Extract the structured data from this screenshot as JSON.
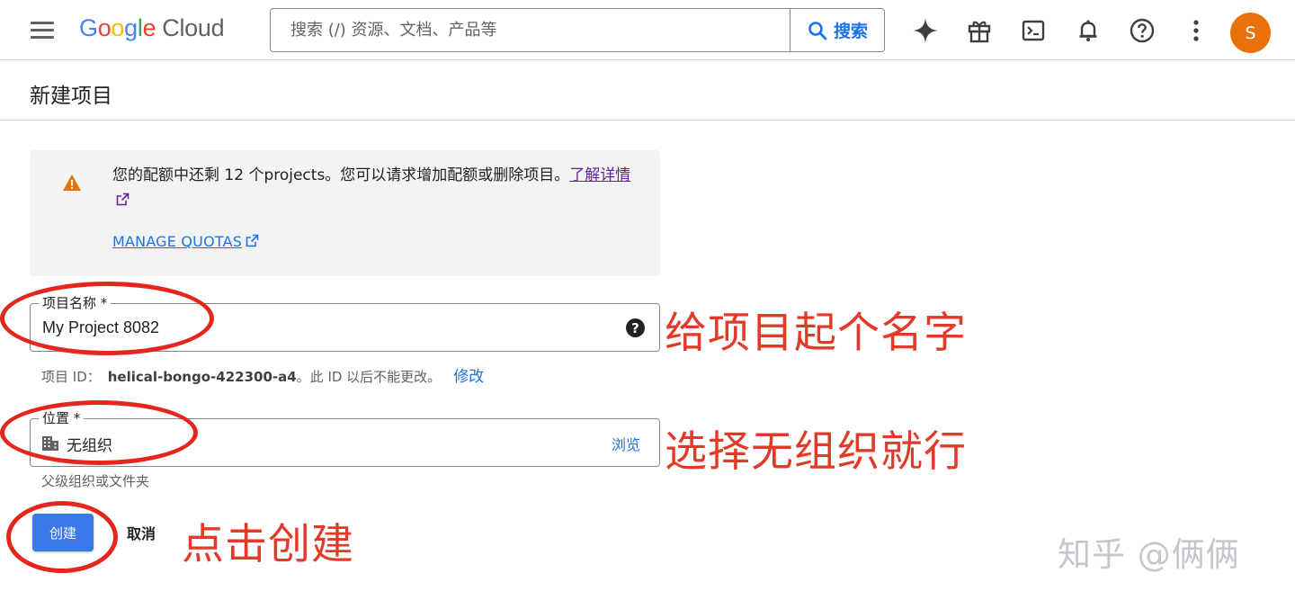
{
  "topbar": {
    "menu_icon": "hamburger-menu-icon",
    "logo": {
      "letters": [
        "G",
        "o",
        "o",
        "g",
        "l",
        "e"
      ],
      "product": "Cloud"
    },
    "search": {
      "placeholder": "搜索 (/) 资源、文档、产品等",
      "value": "",
      "button_label": "搜索"
    },
    "icons": [
      "gemini-sparkle-icon",
      "gift-icon",
      "cloud-shell-terminal-icon",
      "notifications-bell-icon",
      "help-icon",
      "more-vert-icon"
    ],
    "avatar_letter": "S"
  },
  "page": {
    "title": "新建项目"
  },
  "quota_banner": {
    "message": "您的配额中还剩 12 个projects。您可以请求增加配额或删除项目。",
    "learn_more": "了解详情",
    "manage_quotas": "MANAGE QUOTAS"
  },
  "form": {
    "project_name": {
      "label": "项目名称 *",
      "value": "My Project 8082"
    },
    "project_id_hint": {
      "prefix": "项目 ID：",
      "id": "helical-bongo-422300-a4",
      "suffix": "。此 ID 以后不能更改。",
      "edit_label": "修改"
    },
    "location": {
      "label": "位置 *",
      "value": "无组织",
      "browse_label": "浏览",
      "hint": "父级组织或文件夹"
    }
  },
  "actions": {
    "create_label": "创建",
    "cancel_label": "取消"
  },
  "annotations": {
    "name_note": "给项目起个名字",
    "location_note": "选择无组织就行",
    "create_note": "点击创建",
    "watermark": "知乎 @俩俩"
  },
  "colors": {
    "accent": "#1a73e8",
    "annotation_red": "#e13a28",
    "avatar": "#e8710a",
    "warning": "#e37400",
    "banner_bg": "#f1f3f4"
  }
}
